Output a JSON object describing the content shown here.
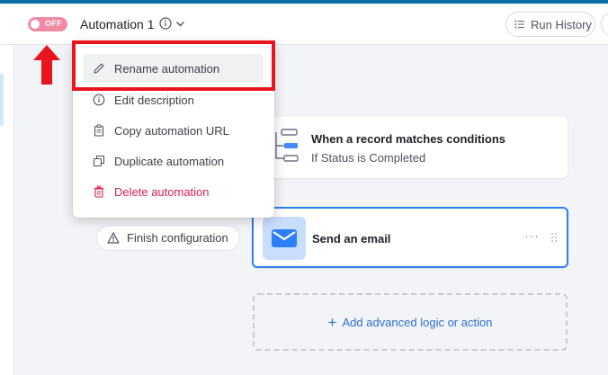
{
  "header": {
    "toggle_label": "OFF",
    "automation_name": "Automation 1",
    "run_history_label": "Run History"
  },
  "menu": {
    "items": [
      {
        "label": "Rename automation",
        "icon": "pencil-icon"
      },
      {
        "label": "Edit description",
        "icon": "info-icon"
      },
      {
        "label": "Copy automation URL",
        "icon": "clipboard-icon"
      },
      {
        "label": "Duplicate automation",
        "icon": "duplicate-icon"
      },
      {
        "label": "Delete automation",
        "icon": "trash-icon"
      }
    ]
  },
  "trigger": {
    "title": "When a record matches conditions",
    "subtitle": "If Status is Completed"
  },
  "action": {
    "title": "Send an email"
  },
  "finish_label": "Finish configuration",
  "add_label": "Add advanced logic or action",
  "colors": {
    "toggle_off": "#ef8ca4",
    "accent_blue": "#2d7ff9",
    "danger": "#dc1f4f",
    "annotation_red": "#e8151e"
  }
}
